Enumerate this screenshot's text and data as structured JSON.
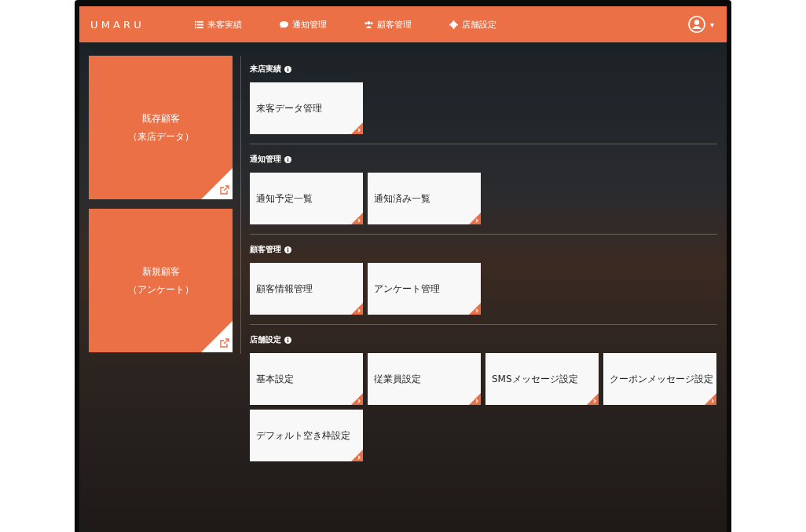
{
  "navbar": {
    "logo": "U M A R U",
    "items": [
      {
        "label": "来客実績"
      },
      {
        "label": "通知管理"
      },
      {
        "label": "顧客管理"
      },
      {
        "label": "店舗設定"
      }
    ],
    "caret": "▾"
  },
  "side_tiles": [
    {
      "title": "既存顧客",
      "subtitle": "（来店データ）"
    },
    {
      "title": "新規顧客",
      "subtitle": "（アンケート）"
    }
  ],
  "sections": [
    {
      "heading": "来店実績",
      "tiles": [
        "来客データ管理"
      ]
    },
    {
      "heading": "通知管理",
      "tiles": [
        "通知予定一覧",
        "通知済み一覧"
      ]
    },
    {
      "heading": "顧客管理",
      "tiles": [
        "顧客情報管理",
        "アンケート管理"
      ]
    },
    {
      "heading": "店舗設定",
      "tiles": [
        "基本設定",
        "従業員設定",
        "SMSメッセージ設定",
        "クーポンメッセージ設定",
        "デフォルト空き枠設定"
      ]
    }
  ]
}
